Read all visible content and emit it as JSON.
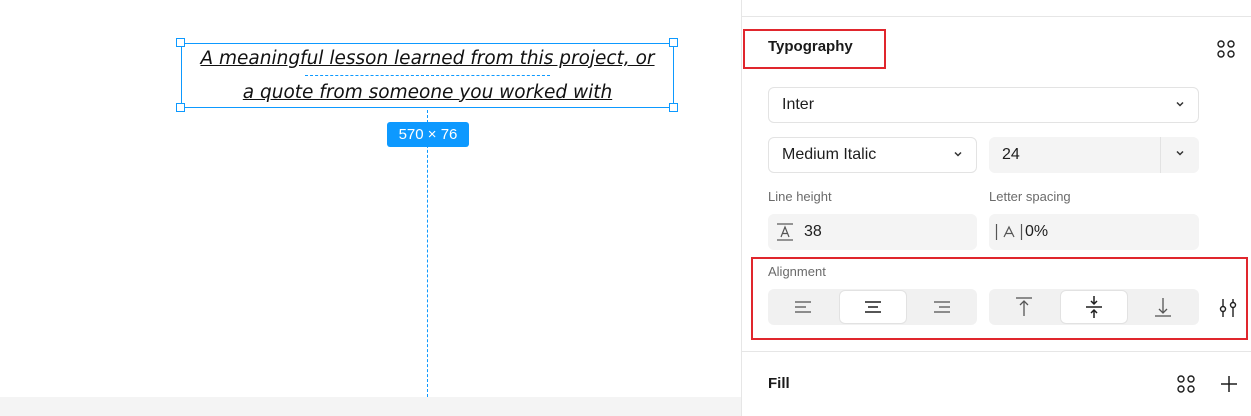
{
  "canvas": {
    "text_lines": [
      "A meaningful lesson learned from this project, or",
      "a quote from someone you worked with"
    ],
    "dimension_badge": "570 × 76"
  },
  "typography": {
    "title": "Typography",
    "font_family": "Inter",
    "font_style": "Medium Italic",
    "font_size": "24",
    "line_height_label": "Line height",
    "line_height_value": "38",
    "letter_spacing_label": "Letter spacing",
    "letter_spacing_value": "0%",
    "alignment_label": "Alignment",
    "horizontal_alignment": "center",
    "vertical_alignment": "middle"
  },
  "fill": {
    "title": "Fill"
  },
  "colors": {
    "selection": "#0d99ff",
    "highlight_box": "#e0262d"
  }
}
